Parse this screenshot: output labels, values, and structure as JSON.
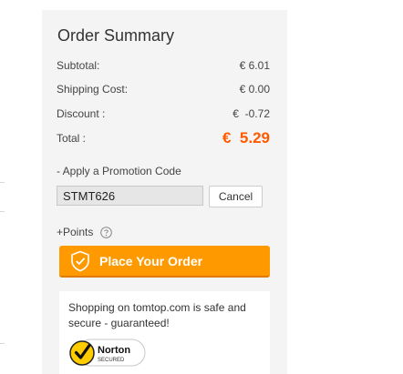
{
  "order_summary": {
    "title": "Order Summary",
    "rows": [
      {
        "label": "Subtotal:",
        "value": "€ 6.01"
      },
      {
        "label": "Shipping Cost:",
        "value": "€ 0.00"
      },
      {
        "label": "Discount :",
        "value": "€  -0.72"
      }
    ],
    "total": {
      "label": "Total :",
      "value": "€  5.29",
      "color": "#ff5a00"
    }
  },
  "promotion": {
    "label": "- Apply a Promotion Code",
    "code_value": "STMT626",
    "cancel_label": "Cancel"
  },
  "points": {
    "label": "+Points",
    "help_icon": "question-circle-icon"
  },
  "place_order": {
    "label": "Place Your Order",
    "icon": "shield-check-icon",
    "color": "#ff9900"
  },
  "security": {
    "text": "Shopping on tomtop.com is safe and secure - guaranteed!",
    "badge_text": "Norton",
    "badge_subtext": "SECURED"
  }
}
